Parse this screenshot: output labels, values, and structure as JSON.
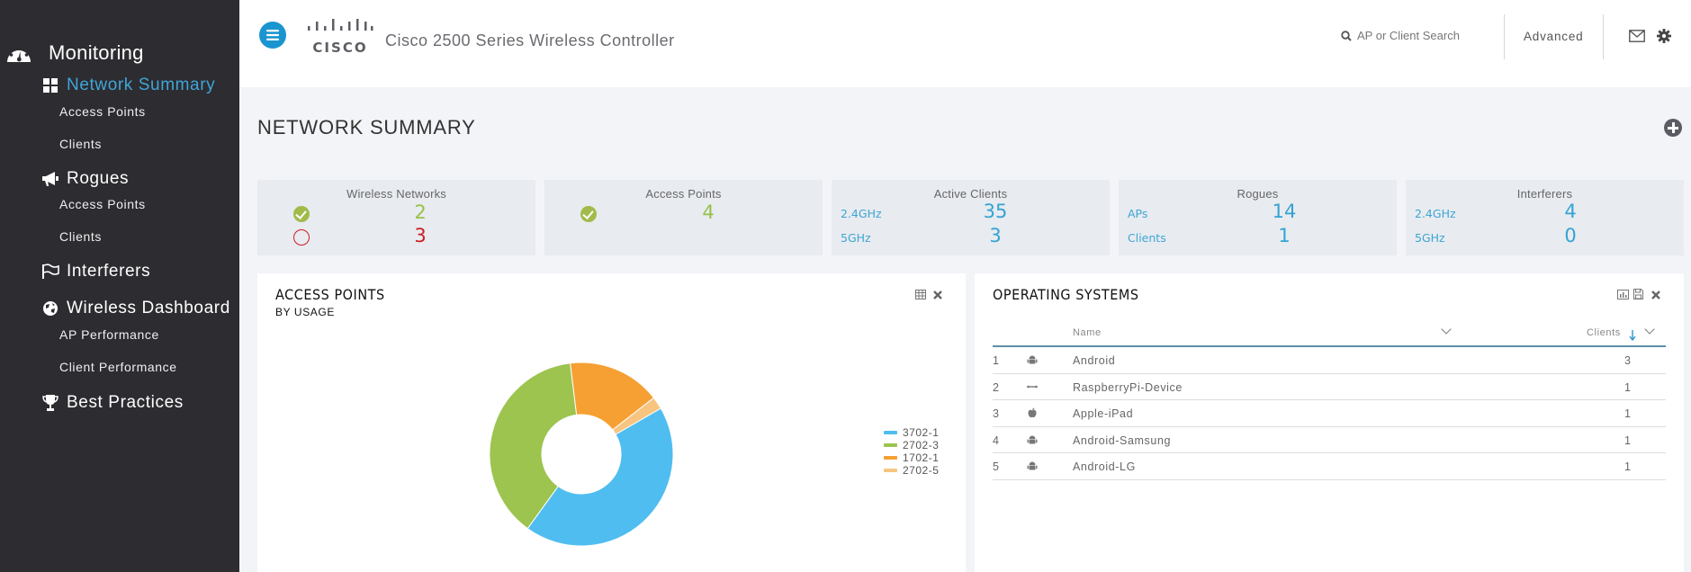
{
  "sidebar": {
    "heading": "Monitoring",
    "sections": [
      {
        "label": "Network Summary",
        "icon": "dashboard-grid-icon",
        "active": true,
        "items": [
          "Access Points",
          "Clients"
        ]
      },
      {
        "label": "Rogues",
        "icon": "megaphone-icon",
        "items": [
          "Access Points",
          "Clients"
        ]
      },
      {
        "label": "Interferers",
        "icon": "flag-icon",
        "items": []
      },
      {
        "label": "Wireless Dashboard",
        "icon": "globe-icon",
        "items": [
          "AP Performance",
          "Client Performance"
        ]
      },
      {
        "label": "Best Practices",
        "icon": "trophy-icon",
        "items": []
      }
    ]
  },
  "header": {
    "logo_text": "CISCO",
    "title": "Cisco 2500 Series Wireless Controller",
    "search_placeholder": "AP or Client Search",
    "advanced_label": "Advanced"
  },
  "page": {
    "title": "NETWORK SUMMARY"
  },
  "tiles": {
    "wireless_networks": {
      "title": "Wireless Networks",
      "enabled": "2",
      "disabled": "3"
    },
    "access_points": {
      "title": "Access Points",
      "value": "4"
    },
    "active_clients": {
      "title": "Active Clients",
      "row1_label": "2.4GHz",
      "row1_value": "35",
      "row2_label": "5GHz",
      "row2_value": "3"
    },
    "rogues": {
      "title": "Rogues",
      "row1_label": "APs",
      "row1_value": "14",
      "row2_label": "Clients",
      "row2_value": "1"
    },
    "interferers": {
      "title": "Interferers",
      "row1_label": "2.4GHz",
      "row1_value": "4",
      "row2_label": "5GHz",
      "row2_value": "0"
    }
  },
  "ap_panel": {
    "title": "ACCESS POINTS",
    "subtitle": "BY USAGE"
  },
  "os_panel": {
    "title": "OPERATING SYSTEMS",
    "columns": {
      "name": "Name",
      "clients": "Clients"
    },
    "rows": [
      {
        "idx": "1",
        "icon": "android-icon",
        "name": "Android",
        "clients": "3"
      },
      {
        "idx": "2",
        "icon": "device-link-icon",
        "name": "RaspberryPi-Device",
        "clients": "1"
      },
      {
        "idx": "3",
        "icon": "apple-icon",
        "name": "Apple-iPad",
        "clients": "1"
      },
      {
        "idx": "4",
        "icon": "android-icon",
        "name": "Android-Samsung",
        "clients": "1"
      },
      {
        "idx": "5",
        "icon": "android-icon",
        "name": "Android-LG",
        "clients": "1"
      }
    ]
  },
  "colors": {
    "accent": "#1b95cf",
    "active_nav": "#3fa5d8",
    "ok_green": "#97c04a",
    "error_red": "#cc1d24",
    "value_blue": "#33a3d4"
  },
  "chart_data": {
    "type": "pie",
    "title": "ACCESS POINTS",
    "subtitle": "BY USAGE",
    "donut": true,
    "legend_position": "right",
    "categories": [
      "3702-1",
      "2702-3",
      "1702-1",
      "2702-5"
    ],
    "values": [
      43.3,
      38.1,
      16.4,
      2.2
    ],
    "colors": [
      "#4fbdf0",
      "#9cc44f",
      "#f6a033",
      "#f7c580"
    ]
  }
}
